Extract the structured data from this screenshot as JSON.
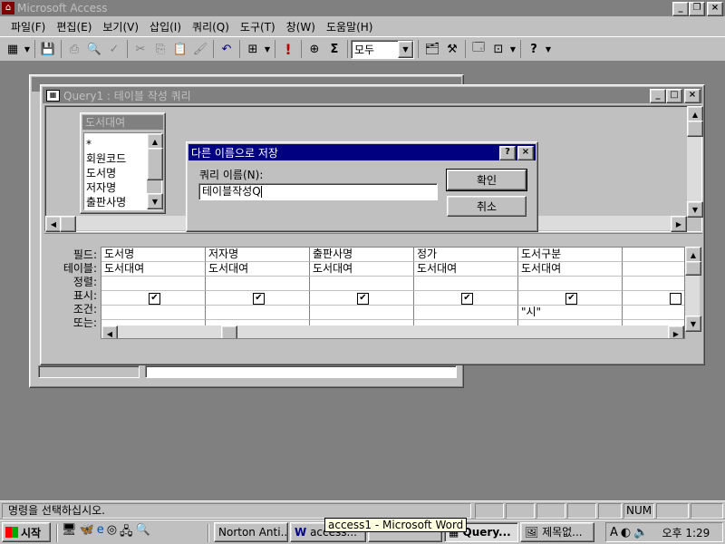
{
  "app": {
    "title": "Microsoft Access"
  },
  "menu": [
    "파일(F)",
    "편집(E)",
    "보기(V)",
    "삽입(I)",
    "쿼리(Q)",
    "도구(T)",
    "창(W)",
    "도움말(H)"
  ],
  "toolbar": {
    "combo_value": "모두"
  },
  "query_window": {
    "title": "Query1 : 테이블 작성 쿼리"
  },
  "table_list": {
    "title": "도서대여",
    "fields": [
      "*",
      "회원코드",
      "도서명",
      "저자명",
      "출판사명"
    ]
  },
  "grid": {
    "row_labels": [
      "필드:",
      "테이블:",
      "정렬:",
      "표시:",
      "조건:",
      "또는:"
    ],
    "columns": [
      {
        "field": "도서명",
        "table": "도서대여",
        "sort": "",
        "show": true,
        "criteria": "",
        "or": ""
      },
      {
        "field": "저자명",
        "table": "도서대여",
        "sort": "",
        "show": true,
        "criteria": "",
        "or": ""
      },
      {
        "field": "출판사명",
        "table": "도서대여",
        "sort": "",
        "show": true,
        "criteria": "",
        "or": ""
      },
      {
        "field": "정가",
        "table": "도서대여",
        "sort": "",
        "show": true,
        "criteria": "",
        "or": ""
      },
      {
        "field": "도서구분",
        "table": "도서대여",
        "sort": "",
        "show": true,
        "criteria": "\"시\"",
        "or": ""
      },
      {
        "field": "",
        "table": "",
        "sort": "",
        "show": false,
        "criteria": "",
        "or": ""
      }
    ]
  },
  "dialog": {
    "title": "다른 이름으로 저장",
    "label": "쿼리 이름(N):",
    "input_value": "테이블작성Q",
    "ok_label": "확인",
    "cancel_label": "취소"
  },
  "status": {
    "text": "명령을 선택하십시오.",
    "num": "NUM"
  },
  "taskbar": {
    "start_label": "시작",
    "tasks": [
      "Norton Anti...",
      "access...",
      "",
      "Query...",
      "제목없..."
    ],
    "tooltip": "access1 - Microsoft Word",
    "clock": "오후 1:29"
  }
}
